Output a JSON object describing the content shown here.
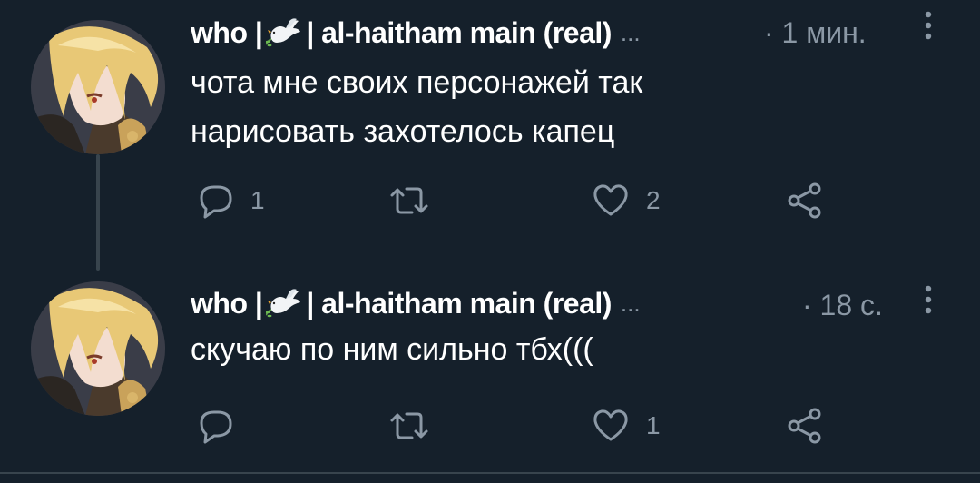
{
  "tweets": [
    {
      "author": {
        "name_prefix": "who |",
        "name_suffix": "| al-haitham main (real)"
      },
      "ellipsis": "...",
      "timestamp": "· 1 мин.",
      "text_lines": [
        "чота мне своих персонажей так",
        "нарисовать захотелось капец"
      ],
      "actions": {
        "reply_count": "1",
        "retweet_count": "",
        "like_count": "2"
      }
    },
    {
      "author": {
        "name_prefix": "who |",
        "name_suffix": "| al-haitham main (real)"
      },
      "ellipsis": "...",
      "timestamp": "· 18 с.",
      "text_lines": [
        "скучаю по ним сильно тбх((("
      ],
      "actions": {
        "reply_count": "",
        "retweet_count": "",
        "like_count": "1"
      }
    }
  ],
  "icons": {
    "name_emoji": "dove-icon",
    "reply": "reply-icon",
    "retweet": "retweet-icon",
    "like": "heart-icon",
    "share": "share-icon",
    "more": "more-vertical-icon"
  },
  "colors": {
    "background": "#15202b",
    "text_primary": "#ffffff",
    "text_secondary": "#8b98a5",
    "divider": "#38444d"
  }
}
